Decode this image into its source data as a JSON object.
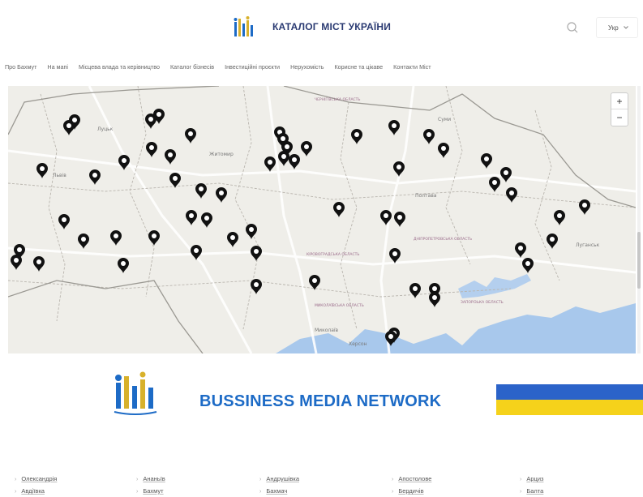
{
  "header": {
    "title": "КАТАЛОГ МІСТ УКРАЇНИ",
    "search_icon": "search-icon",
    "language": "Укр"
  },
  "nav": {
    "items": [
      "Про Бахмут",
      "На мапі",
      "Місцева влада та керівництво",
      "Каталог бізнесів",
      "Інвестиційні проєкти",
      "Нерухомість",
      "Корисне та цікаве",
      "Контакти Міст"
    ]
  },
  "map": {
    "labels": [
      "ЧЕРНІГІВСЬКА ОБЛАСТЬ",
      "Суми",
      "Луцьк",
      "Житомир",
      "Львів",
      "Полтава",
      "ДНІПРОПЕТРОВСЬКА ОБЛАСТЬ",
      "КІРОВОГРАДСЬКА ОБЛАСТЬ",
      "Луганськ",
      "МИКОЛАЇВСЬКА ОБЛАСТЬ",
      "ЗАПОРІЗЬКА ОБЛАСТЬ",
      "Миколаїв",
      "Херсон"
    ],
    "zoom_in": "+",
    "zoom_out": "−",
    "marker_icon": "map-pin-icon",
    "colors": {
      "land": "#efeee9",
      "water": "#a8c8ec",
      "road": "#ffffff",
      "border": "#b9b5ae",
      "pin": "#111111"
    }
  },
  "banner": {
    "title": "BUSSINESS MEDIA NETWORK",
    "flag_colors": {
      "top": "#2b63c9",
      "bottom": "#f5d21b"
    }
  },
  "cities": {
    "row1": [
      "Олександрія",
      "Ананьїв",
      "Андрушівка",
      "Апостолове",
      "Арциз"
    ],
    "row2": [
      "Авдіївка",
      "Бахмут",
      "Бахмач",
      "Бердичів",
      "Балта"
    ]
  }
}
